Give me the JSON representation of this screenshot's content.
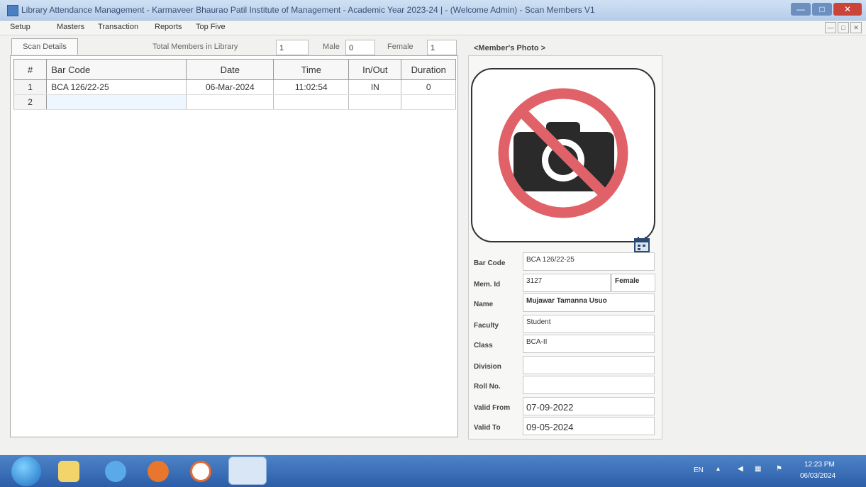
{
  "window": {
    "title": "Library Attendance Management - Karmaveer Bhaurao Patil Institute of Management - Academic Year 2023-24 | - (Welcome Admin) - Scan Members V1"
  },
  "window_controls": {
    "minimize": "—",
    "maximize": "□",
    "close": "✕"
  },
  "menu": {
    "items": [
      "Setup",
      "Masters",
      "Transaction",
      "Reports",
      "Top Five"
    ]
  },
  "tabs": {
    "scan_details": "Scan Details"
  },
  "stats": {
    "total_label": "Total Members in Library",
    "total_value": "1",
    "male_label": "Male",
    "male_value": "0",
    "female_label": "Female",
    "female_value": "1"
  },
  "table": {
    "headers": [
      "#",
      "Bar Code",
      "Date",
      "Time",
      "In/Out",
      "Duration"
    ],
    "rows": [
      {
        "num": "1",
        "barcode": "BCA 126/22-25",
        "date": "06-Mar-2024",
        "time": "11:02:54",
        "inout": "IN",
        "duration": "0"
      },
      {
        "num": "2",
        "barcode": "",
        "date": "",
        "time": "",
        "inout": "",
        "duration": ""
      }
    ]
  },
  "member": {
    "photo_heading": "<Member's Photo >",
    "labels": {
      "barcode": "Bar Code",
      "mem_id": "Mem. Id",
      "name": "Name",
      "faculty": "Faculty",
      "class": "Class",
      "division": "Division",
      "roll_no": "Roll No.",
      "valid_from": "Valid From",
      "valid_to": "Valid To"
    },
    "values": {
      "barcode": "BCA 126/22-25",
      "mem_id": "3127",
      "gender": "Female",
      "name": "Mujawar Tamanna Usuo",
      "faculty": "Student",
      "class": "BCA-II",
      "division": "",
      "roll_no": "",
      "valid_from": "07-09-2022",
      "valid_to": "09-05-2024"
    }
  },
  "icons": {
    "photo": "no-camera-icon",
    "calendar": "calendar-icon"
  },
  "taskbar": {
    "tray_lang": "EN",
    "time": "12:23 PM",
    "date": "06/03/2024"
  }
}
